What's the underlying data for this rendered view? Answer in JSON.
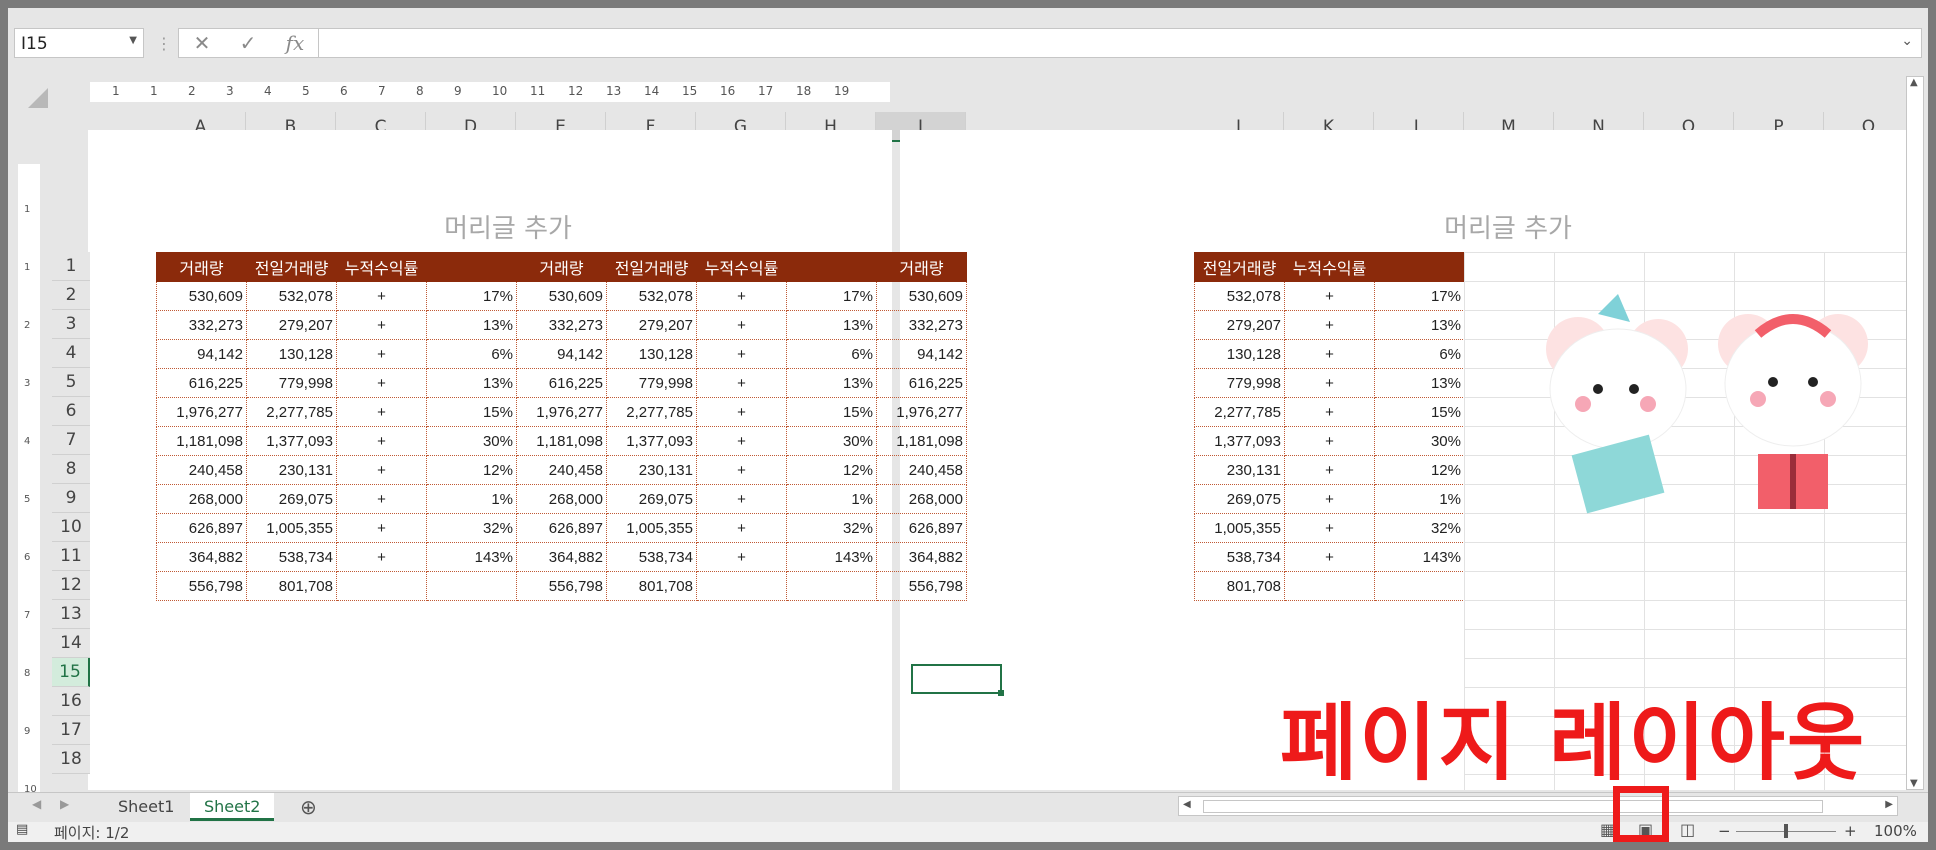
{
  "name_box": {
    "value": "I15"
  },
  "formula_bar": {
    "cancel": "✕",
    "enter": "✓",
    "fx": "fx",
    "value": ""
  },
  "columns_left": [
    "A",
    "B",
    "C",
    "D",
    "E",
    "F",
    "G",
    "H",
    "I"
  ],
  "columns_right": [
    "J",
    "K",
    "L",
    "M",
    "N",
    "O",
    "P",
    "Q"
  ],
  "selected_column": "I",
  "ruler_left": [
    "1",
    "1",
    "2",
    "3",
    "4",
    "5",
    "6",
    "7",
    "8",
    "9",
    "10",
    "11",
    "12",
    "13",
    "14",
    "15",
    "16",
    "17",
    "18",
    "19"
  ],
  "vruler": [
    "1",
    "1",
    "2",
    "3",
    "4",
    "5",
    "6",
    "7",
    "8",
    "9",
    "10"
  ],
  "rows": [
    "1",
    "2",
    "3",
    "4",
    "5",
    "6",
    "7",
    "8",
    "9",
    "10",
    "11",
    "12",
    "13",
    "14",
    "15",
    "16",
    "17",
    "18"
  ],
  "selected_row": "15",
  "page1": {
    "header_placeholder": "머리글 추가",
    "headers": [
      "거래량",
      "전일거래량",
      "누적수익률",
      "",
      "거래량",
      "전일거래량",
      "누적수익률",
      "",
      "거래량"
    ],
    "data": [
      [
        "530,609",
        "532,078",
        "+",
        "17%",
        "530,609",
        "532,078",
        "+",
        "17%",
        "530,609"
      ],
      [
        "332,273",
        "279,207",
        "+",
        "13%",
        "332,273",
        "279,207",
        "+",
        "13%",
        "332,273"
      ],
      [
        "94,142",
        "130,128",
        "+",
        "6%",
        "94,142",
        "130,128",
        "+",
        "6%",
        "94,142"
      ],
      [
        "616,225",
        "779,998",
        "+",
        "13%",
        "616,225",
        "779,998",
        "+",
        "13%",
        "616,225"
      ],
      [
        "1,976,277",
        "2,277,785",
        "+",
        "15%",
        "1,976,277",
        "2,277,785",
        "+",
        "15%",
        "1,976,277"
      ],
      [
        "1,181,098",
        "1,377,093",
        "+",
        "30%",
        "1,181,098",
        "1,377,093",
        "+",
        "30%",
        "1,181,098"
      ],
      [
        "240,458",
        "230,131",
        "+",
        "12%",
        "240,458",
        "230,131",
        "+",
        "12%",
        "240,458"
      ],
      [
        "268,000",
        "269,075",
        "+",
        "1%",
        "268,000",
        "269,075",
        "+",
        "1%",
        "268,000"
      ],
      [
        "626,897",
        "1,005,355",
        "+",
        "32%",
        "626,897",
        "1,005,355",
        "+",
        "32%",
        "626,897"
      ],
      [
        "364,882",
        "538,734",
        "+",
        "143%",
        "364,882",
        "538,734",
        "+",
        "143%",
        "364,882"
      ],
      [
        "556,798",
        "801,708",
        "",
        "",
        "556,798",
        "801,708",
        "",
        "",
        "556,798"
      ]
    ]
  },
  "page2": {
    "header_placeholder": "머리글 추가",
    "headers": [
      "전일거래량",
      "누적수익률",
      ""
    ],
    "data": [
      [
        "532,078",
        "+",
        "17%"
      ],
      [
        "279,207",
        "+",
        "13%"
      ],
      [
        "130,128",
        "+",
        "6%"
      ],
      [
        "779,998",
        "+",
        "13%"
      ],
      [
        "2,277,785",
        "+",
        "15%"
      ],
      [
        "1,377,093",
        "+",
        "30%"
      ],
      [
        "230,131",
        "+",
        "12%"
      ],
      [
        "269,075",
        "+",
        "1%"
      ],
      [
        "1,005,355",
        "+",
        "32%"
      ],
      [
        "538,734",
        "+",
        "143%"
      ],
      [
        "801,708",
        "",
        ""
      ]
    ]
  },
  "banner": "페이지 레이아웃",
  "tabs": [
    "Sheet1",
    "Sheet2"
  ],
  "active_tab": "Sheet2",
  "add_sheet": "⊕",
  "status": {
    "page": "페이지: 1/2",
    "zoom": "100%",
    "minus": "−",
    "plus": "+"
  },
  "colors": {
    "header_bg": "#8b2a0b",
    "accent": "#217346",
    "banner": "#ee1a1a"
  }
}
